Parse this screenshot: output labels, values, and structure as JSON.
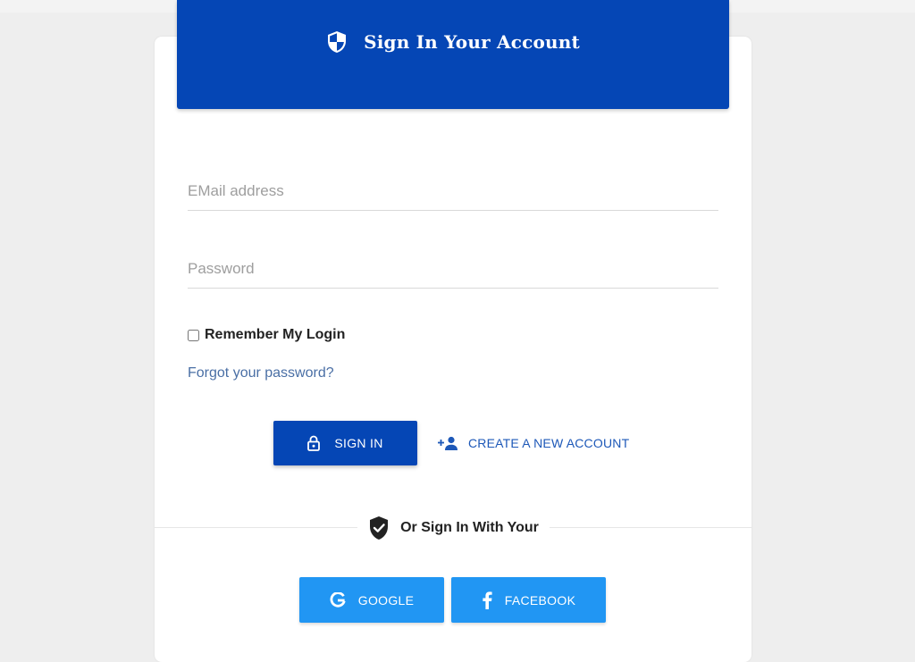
{
  "header": {
    "title": "Sign In Your Account",
    "icon": "shield-icon",
    "background_color": "#0546b5"
  },
  "form": {
    "email": {
      "placeholder": "EMail address",
      "value": ""
    },
    "password": {
      "placeholder": "Password",
      "value": ""
    },
    "remember": {
      "label": "Remember My Login",
      "checked": false
    },
    "forgot_link": "Forgot your password?"
  },
  "actions": {
    "signin_label": "SIGN IN",
    "signin_icon": "lock-icon",
    "create_label": "CREATE A NEW ACCOUNT",
    "create_icon": "add-user-icon"
  },
  "social": {
    "divider_label": "Or Sign In With Your",
    "divider_icon": "shield-check-icon",
    "google_label": "GOOGLE",
    "google_icon": "google-icon",
    "facebook_label": "FACEBOOK",
    "facebook_icon": "facebook-icon",
    "button_color": "#2196f3"
  }
}
